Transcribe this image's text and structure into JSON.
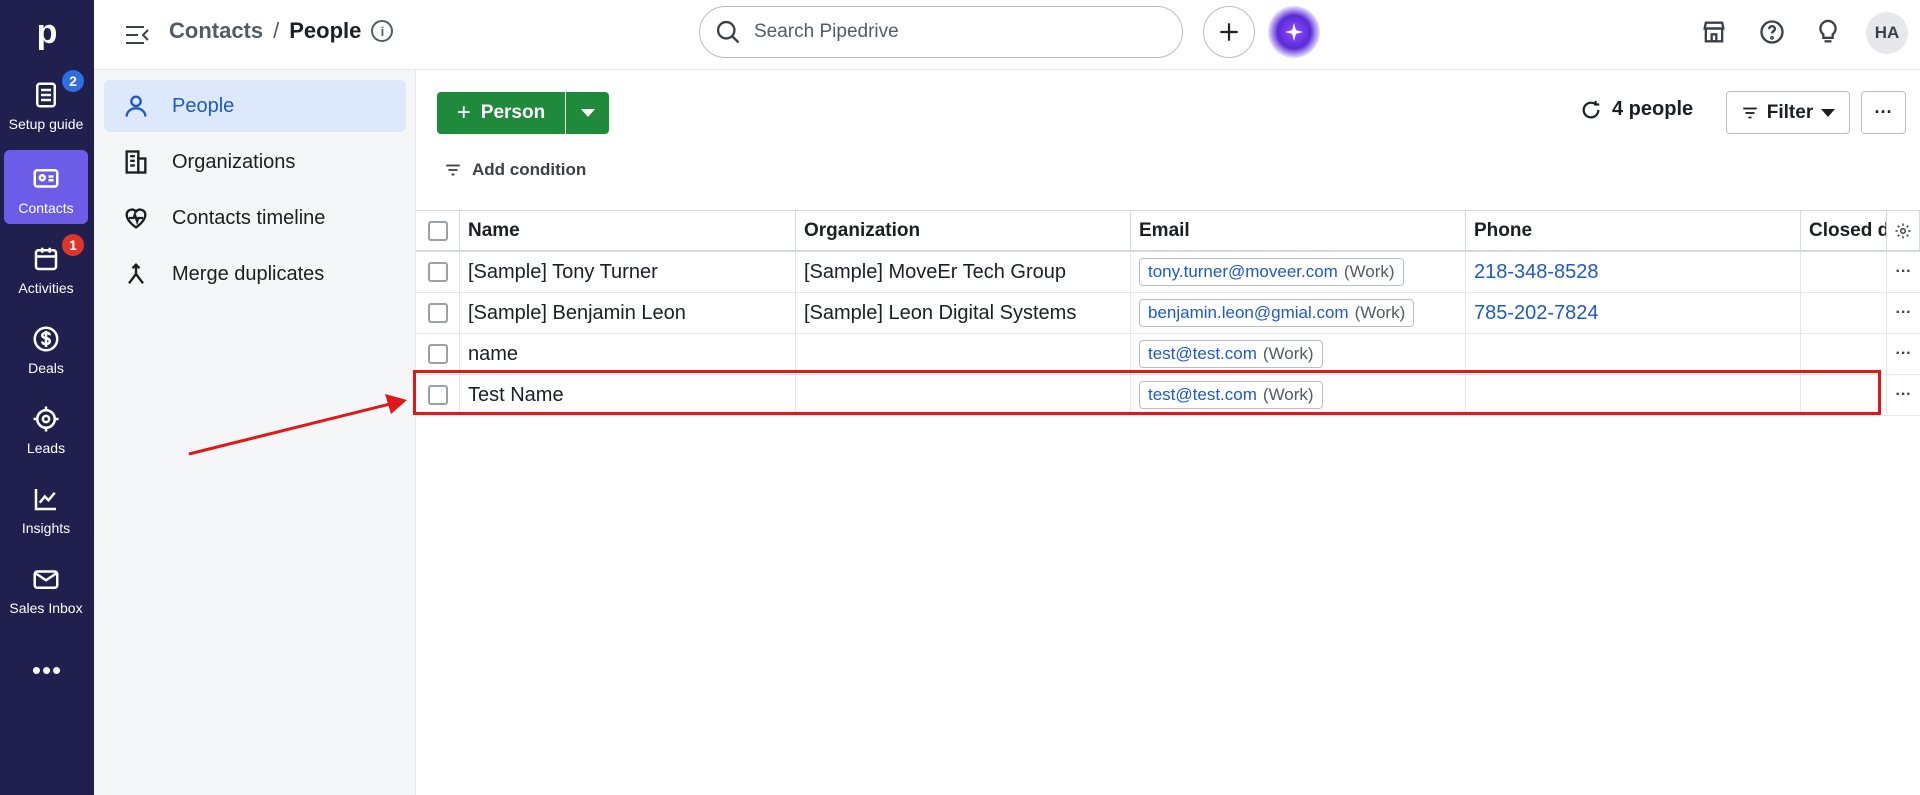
{
  "rail": {
    "logo": "p",
    "items": [
      {
        "label": "Setup guide",
        "icon": "checklist-icon",
        "badge": "2"
      },
      {
        "label": "Contacts",
        "icon": "contacts-card-icon"
      },
      {
        "label": "Activities",
        "icon": "calendar-icon",
        "badge": "1"
      },
      {
        "label": "Deals",
        "icon": "dollar-icon"
      },
      {
        "label": "Leads",
        "icon": "target-icon"
      },
      {
        "label": "Insights",
        "icon": "chart-icon"
      },
      {
        "label": "Sales Inbox",
        "icon": "mail-icon"
      }
    ],
    "more": "•••"
  },
  "header": {
    "breadcrumb_parent": "Contacts",
    "breadcrumb_sep": "/",
    "breadcrumb_current": "People",
    "info": "i",
    "search_placeholder": "Search Pipedrive",
    "avatar": "HA"
  },
  "subnav": {
    "items": [
      {
        "label": "People",
        "icon": "person-icon"
      },
      {
        "label": "Organizations",
        "icon": "building-icon"
      },
      {
        "label": "Contacts timeline",
        "icon": "heartbeat-icon"
      },
      {
        "label": "Merge duplicates",
        "icon": "merge-icon"
      }
    ]
  },
  "toolbar": {
    "add_plus": "+",
    "add_label": "Person",
    "count_label": "4 people",
    "filter_label": "Filter",
    "more_label": "···",
    "add_condition": "Add condition"
  },
  "table": {
    "columns": [
      "Name",
      "Organization",
      "Email",
      "Phone",
      "Closed d"
    ],
    "rows": [
      {
        "name": "[Sample] Tony Turner",
        "org": "[Sample] MoveEr Tech Group",
        "email": "tony.turner@moveer.com",
        "email_tag": "(Work)",
        "phone": "218-348-8528"
      },
      {
        "name": "[Sample] Benjamin Leon",
        "org": "[Sample] Leon Digital Systems",
        "email": "benjamin.leon@gmial.com",
        "email_tag": "(Work)",
        "phone": "785-202-7824"
      },
      {
        "name": "name",
        "org": "",
        "email": "test@test.com",
        "email_tag": "(Work)",
        "phone": ""
      },
      {
        "name": "Test Name",
        "org": "",
        "email": "test@test.com",
        "email_tag": "(Work)",
        "phone": ""
      }
    ],
    "row_more": "···"
  },
  "colors": {
    "rail_bg": "#201f4e",
    "rail_active": "#6d5ce8",
    "primary_green": "#1f8a3b",
    "link_blue": "#1d5bc4",
    "highlight_red": "#e01818"
  }
}
